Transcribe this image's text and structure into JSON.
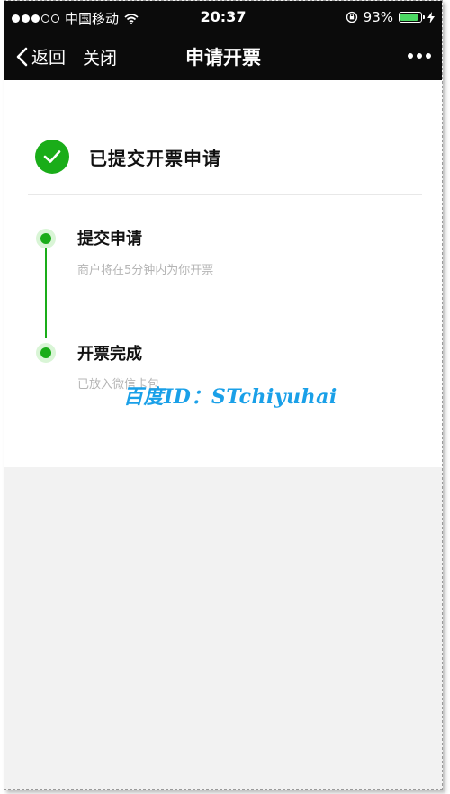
{
  "status_bar": {
    "carrier": "中国移动",
    "time": "20:37",
    "battery_percent": "93%",
    "battery_level": 0.93,
    "signal_bars_filled": 3,
    "signal_bars_total": 5,
    "battery_color": "#4cd964"
  },
  "nav": {
    "back_label": "返回",
    "close_label": "关闭",
    "title": "申请开票"
  },
  "result": {
    "title": "已提交开票申请",
    "icon": "check-circle-icon",
    "accent_color": "#1aad19"
  },
  "steps": [
    {
      "title": "提交申请",
      "subtitle": "商户将在5分钟内为你开票"
    },
    {
      "title": "开票完成",
      "subtitle": "已放入微信卡包"
    }
  ],
  "watermark": "百度ID：STchiyuhai"
}
